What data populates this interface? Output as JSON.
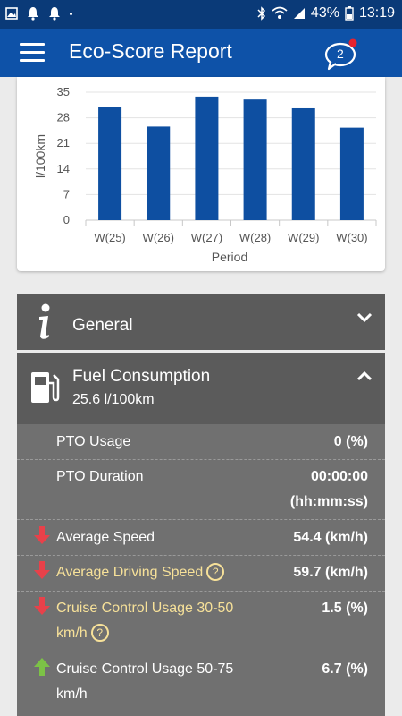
{
  "status_bar": {
    "battery": "43%",
    "time": "13:19"
  },
  "app_bar": {
    "title": "Eco-Score Report",
    "chat_badge_count": "2"
  },
  "chart_data": {
    "type": "bar",
    "categories": [
      "W(25)",
      "W(26)",
      "W(27)",
      "W(28)",
      "W(29)",
      "W(30)"
    ],
    "values": [
      31,
      25.6,
      33.8,
      33,
      30.6,
      25.3
    ],
    "yticks": [
      35,
      28,
      21,
      14,
      7,
      0
    ],
    "ylabel": "l/100km",
    "xlabel": "Period",
    "ylim": [
      0,
      35
    ],
    "bar_color": "#0e4fa1",
    "grid": true
  },
  "sections": {
    "general": {
      "title": "General"
    },
    "fuel": {
      "title": "Fuel Consumption",
      "subtitle": "25.6 l/100km"
    }
  },
  "rows": [
    {
      "label": "PTO Usage",
      "value": "0",
      "unit": "(%)",
      "trend": "none",
      "warn": false,
      "help": false
    },
    {
      "label": "PTO Duration",
      "value": "00:00:00",
      "unit": "(hh:mm:ss)",
      "trend": "none",
      "warn": false,
      "help": false
    },
    {
      "label": "Average Speed",
      "value": "54.4",
      "unit": "(km/h)",
      "trend": "down",
      "warn": false,
      "help": false
    },
    {
      "label": "Average Driving Speed",
      "value": "59.7",
      "unit": "(km/h)",
      "trend": "down",
      "warn": true,
      "help": true
    },
    {
      "label_line1": "Cruise Control Usage 30-50",
      "label_line2": "km/h",
      "value": "1.5",
      "unit": "(%)",
      "trend": "down",
      "warn": true,
      "help": true
    },
    {
      "label_line1": "Cruise Control Usage 50-75",
      "label_line2": "km/h",
      "value": "6.7",
      "unit": "(%)",
      "trend": "up",
      "warn": false,
      "help": false
    }
  ],
  "colors": {
    "down_arrow": "#e8414a",
    "up_arrow": "#7cc246",
    "warn_text": "#f7e199"
  }
}
